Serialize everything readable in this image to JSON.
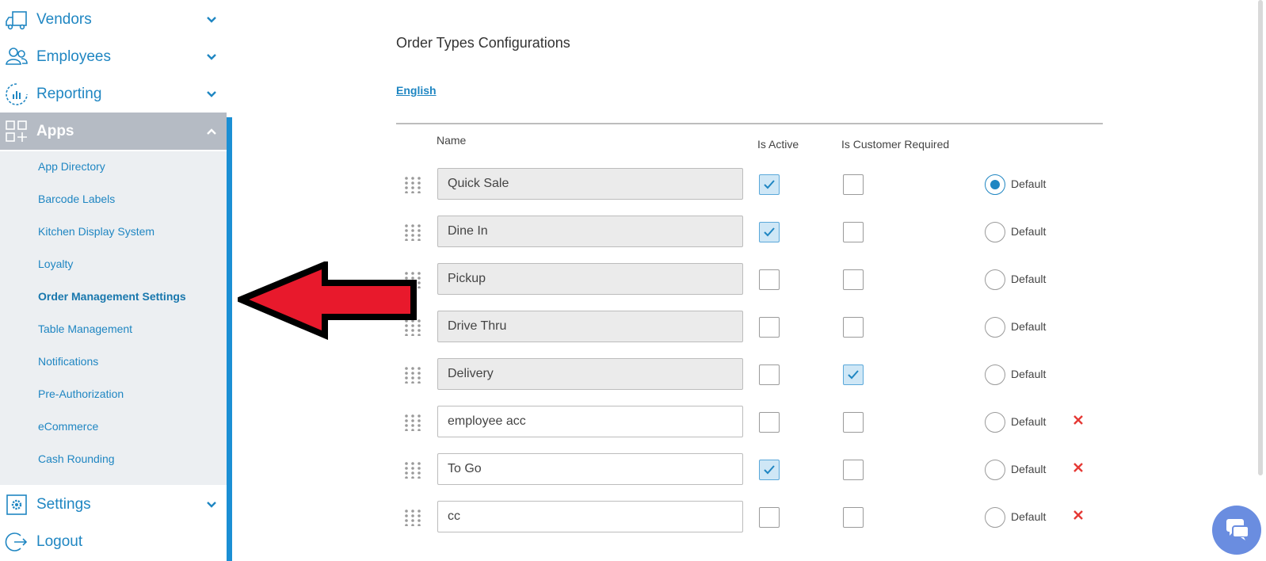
{
  "sidebar": {
    "items": [
      {
        "label": "Vendors",
        "icon": "truck-icon"
      },
      {
        "label": "Employees",
        "icon": "users-icon"
      },
      {
        "label": "Reporting",
        "icon": "chart-icon"
      },
      {
        "label": "Apps",
        "icon": "apps-grid-icon"
      },
      {
        "label": "Settings",
        "icon": "gear-icon"
      },
      {
        "label": "Logout",
        "icon": "logout-icon"
      }
    ],
    "apps_submenu": [
      {
        "label": "App Directory"
      },
      {
        "label": "Barcode Labels"
      },
      {
        "label": "Kitchen Display System"
      },
      {
        "label": "Loyalty"
      },
      {
        "label": "Order Management Settings",
        "active": true
      },
      {
        "label": "Table Management"
      },
      {
        "label": "Notifications"
      },
      {
        "label": "Pre-Authorization"
      },
      {
        "label": "eCommerce"
      },
      {
        "label": "Cash Rounding"
      }
    ]
  },
  "main": {
    "title": "Order Types Configurations",
    "language_tab": "English",
    "columns": {
      "name": "Name",
      "is_active": "Is Active",
      "is_customer_required": "Is Customer Required"
    },
    "rows": [
      {
        "name": "Quick Sale",
        "readonly": true,
        "is_active": true,
        "customer_required": false,
        "default": true,
        "default_label": "Default",
        "deletable": false
      },
      {
        "name": "Dine In",
        "readonly": true,
        "is_active": true,
        "customer_required": false,
        "default": false,
        "default_label": "Default",
        "deletable": false
      },
      {
        "name": "Pickup",
        "readonly": true,
        "is_active": false,
        "customer_required": false,
        "default": false,
        "default_label": "Default",
        "deletable": false
      },
      {
        "name": "Drive Thru",
        "readonly": true,
        "is_active": false,
        "customer_required": false,
        "default": false,
        "default_label": "Default",
        "deletable": false
      },
      {
        "name": "Delivery",
        "readonly": true,
        "is_active": false,
        "customer_required": true,
        "default": false,
        "default_label": "Default",
        "deletable": false
      },
      {
        "name": "employee acc",
        "readonly": false,
        "is_active": false,
        "customer_required": false,
        "default": false,
        "default_label": "Default",
        "deletable": true
      },
      {
        "name": "To Go",
        "readonly": false,
        "is_active": true,
        "customer_required": false,
        "default": false,
        "default_label": "Default",
        "deletable": true
      },
      {
        "name": "cc",
        "readonly": false,
        "is_active": false,
        "customer_required": false,
        "default": false,
        "default_label": "Default",
        "deletable": true
      }
    ]
  },
  "colors": {
    "accent": "#1f86c2",
    "apps_header_bg": "#b5bbc4",
    "submenu_bg": "#eceff2",
    "delete": "#e53935",
    "arrow_fill": "#e8192c",
    "chat_button": "#6a8de0"
  }
}
